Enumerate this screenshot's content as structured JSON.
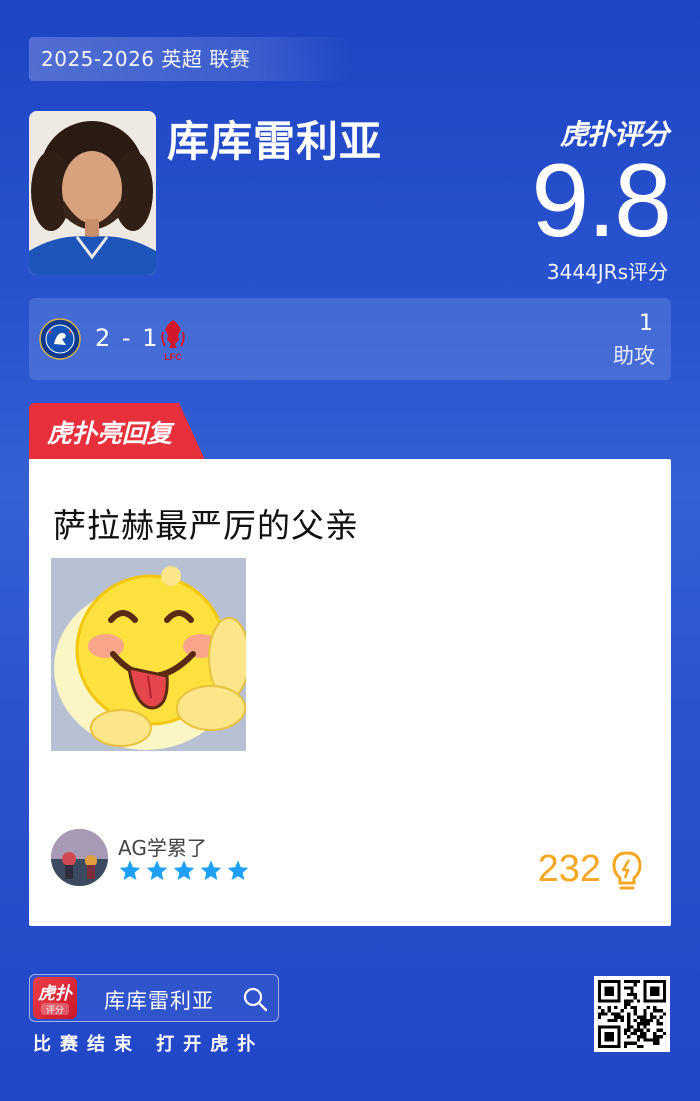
{
  "header": {
    "season": "2025-2026 英超 联赛",
    "player_name": "库库雷利亚",
    "brand": "虎扑评分",
    "score": "9.8",
    "jrs_count": "3444JRs评分"
  },
  "match": {
    "score": "2 - 1",
    "home_club_icon": "chelsea-crest-icon",
    "away_club_icon": "liverpool-crest-icon",
    "stat_value": "1",
    "stat_label": "助攻"
  },
  "highlight": {
    "tag": "虎扑亮回复",
    "comment": "萨拉赫最严厉的父亲",
    "username": "AG学累了",
    "stars": 5,
    "likes": "232"
  },
  "footer": {
    "search_text": "库库雷利亚",
    "tagline": "比赛结束 打开虎扑",
    "app_icon_label": "虎扑",
    "app_icon_sub": "评分"
  },
  "colors": {
    "accent_red": "#e8303c",
    "star_blue": "#1ea1f2",
    "likes_orange": "#f5a623"
  }
}
